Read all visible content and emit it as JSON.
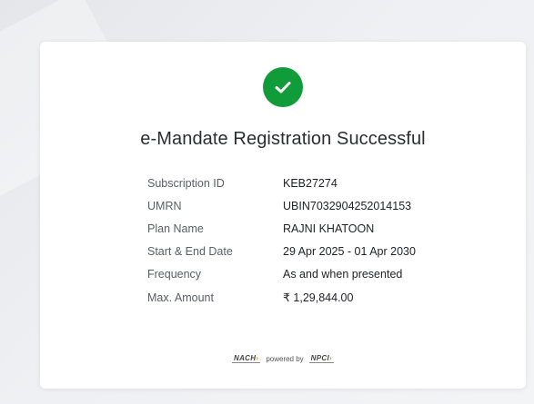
{
  "status": {
    "icon": "check-icon",
    "color": "#119c3a",
    "title": "e-Mandate Registration Successful"
  },
  "details": [
    {
      "label": "Subscription ID",
      "value": "KEB27274"
    },
    {
      "label": "UMRN",
      "value": "UBIN7032904252014153"
    },
    {
      "label": "Plan Name",
      "value": "RAJNI KHATOON"
    },
    {
      "label": "Start & End Date",
      "value": "29 Apr 2025 - 01 Apr 2030"
    },
    {
      "label": "Frequency",
      "value": "As and when presented"
    },
    {
      "label": "Max. Amount",
      "value": "₹ 1,29,844.00"
    }
  ],
  "footer": {
    "nach_logo": "NACH",
    "powered_by": "powered by",
    "npci_logo": "NPCI"
  }
}
